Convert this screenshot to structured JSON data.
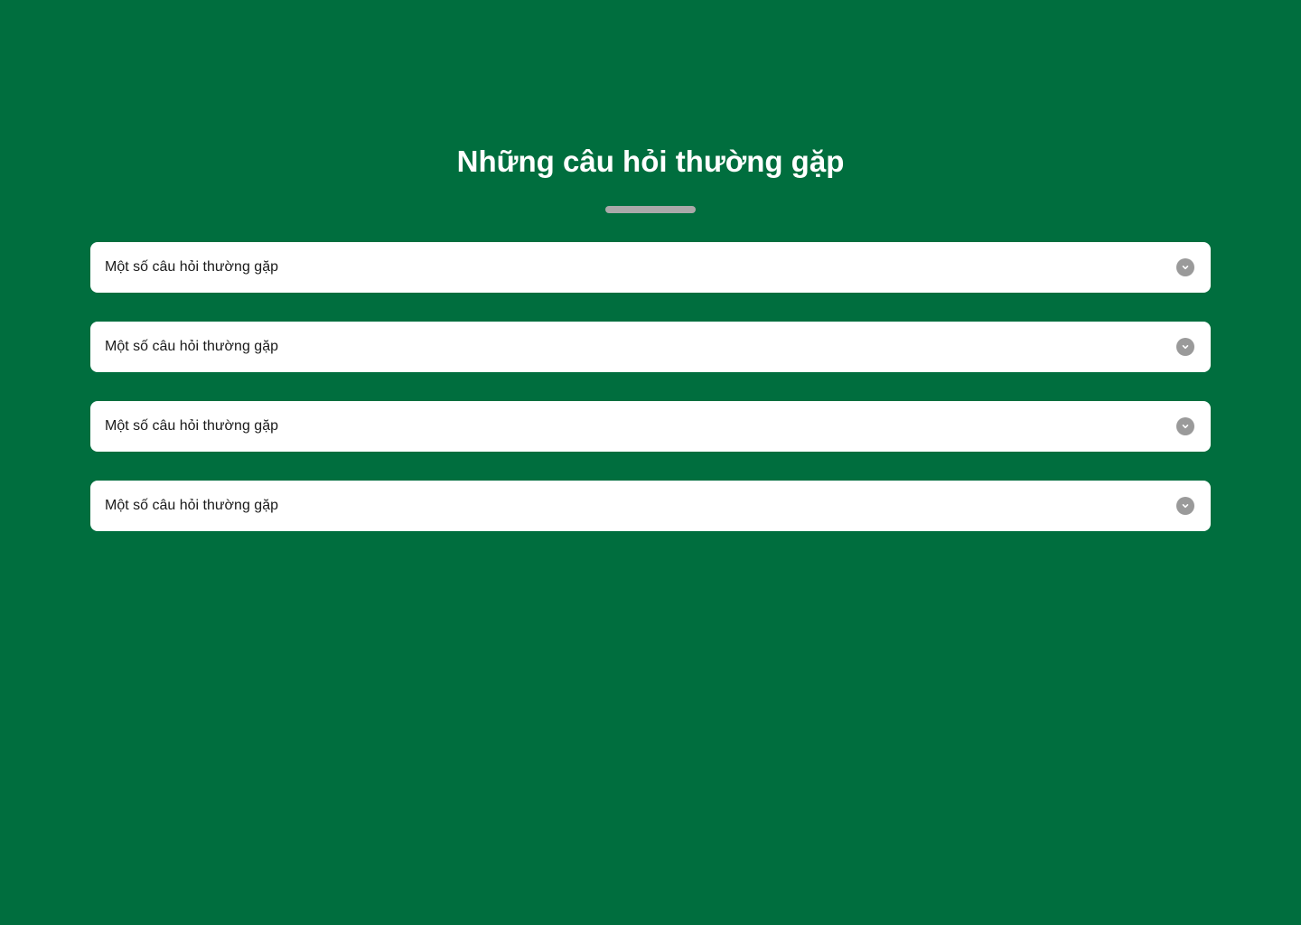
{
  "page": {
    "title": "Những câu hỏi thường gặp",
    "background_color": "#006e3e",
    "divider_color": "#a9a9a9"
  },
  "faq": {
    "items": [
      {
        "question": "Một số câu hỏi thường gặp",
        "icon": "chevron-down-icon",
        "expanded": false
      },
      {
        "question": "Một số câu hỏi thường gặp",
        "icon": "chevron-down-icon",
        "expanded": false
      },
      {
        "question": "Một số câu hỏi thường gặp",
        "icon": "chevron-down-icon",
        "expanded": false
      },
      {
        "question": "Một số câu hỏi thường gặp",
        "icon": "chevron-down-icon",
        "expanded": false
      }
    ]
  }
}
